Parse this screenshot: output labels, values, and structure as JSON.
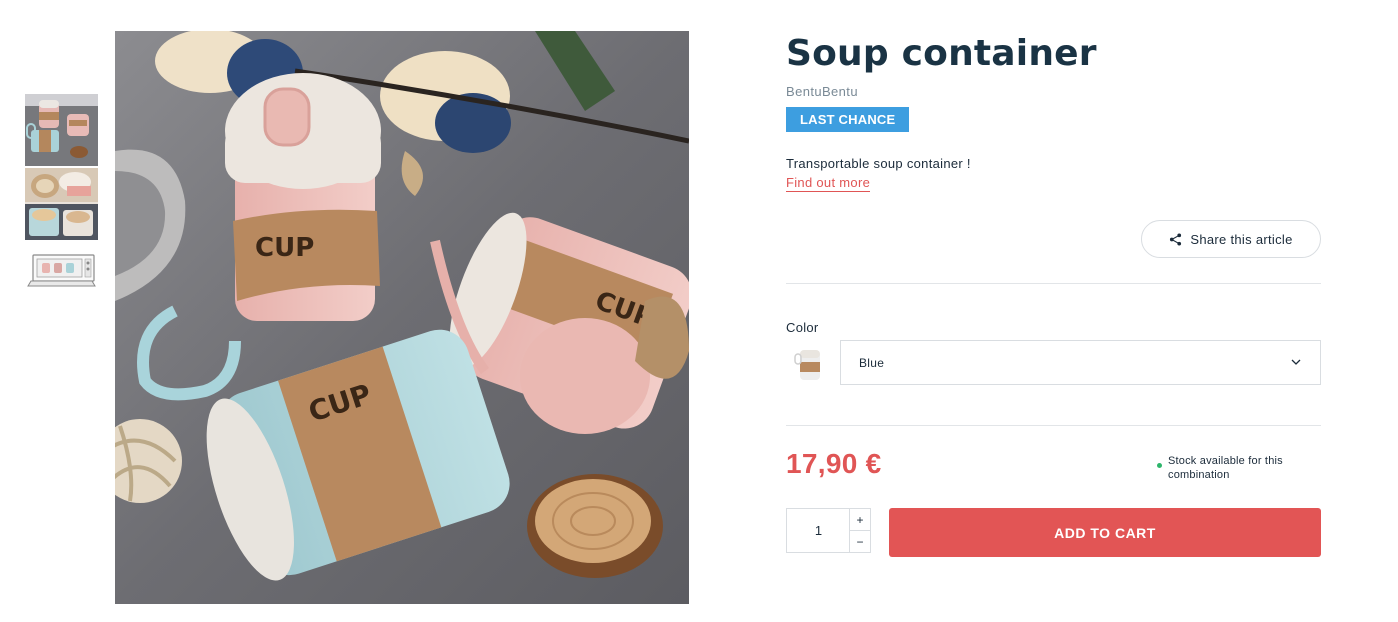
{
  "product": {
    "title": "Soup container",
    "brand": "BentuBentu",
    "badge": "LAST CHANCE",
    "description": "Transportable soup container !",
    "find_out_more": "Find out more",
    "share_label": "Share this article"
  },
  "variant": {
    "color_label": "Color",
    "selected_color": "Blue"
  },
  "pricing": {
    "price": "17,90 €",
    "stock_text": "Stock available for this combination"
  },
  "cart": {
    "quantity": "1",
    "increment": "+",
    "decrement": "−",
    "add_to_cart_label": "ADD TO CART"
  },
  "gallery": {
    "thumbnails": [
      "thumbnail-cups",
      "thumbnail-lifestyle",
      "thumbnail-oven"
    ],
    "main_image": "soup-containers-photo"
  },
  "colors": {
    "accent": "#e25555",
    "badge": "#3d9ee0",
    "title": "#1a3344",
    "stock": "#2db56b"
  },
  "icons": {
    "share": "share-icon",
    "chevron": "chevron-down-icon"
  }
}
